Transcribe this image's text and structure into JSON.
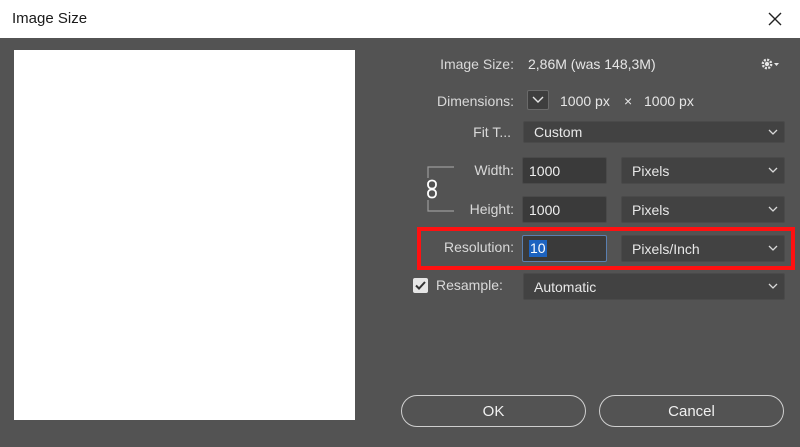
{
  "window": {
    "title": "Image Size"
  },
  "image_size": {
    "label": "Image Size:",
    "value": "2,86M (was 148,3M)"
  },
  "dimensions": {
    "label": "Dimensions:",
    "width": "1000 px",
    "times": "×",
    "height": "1000 px"
  },
  "fit_to": {
    "label": "Fit T...",
    "value": "Custom"
  },
  "width": {
    "label": "Width:",
    "value": "1000",
    "unit": "Pixels"
  },
  "height": {
    "label": "Height:",
    "value": "1000",
    "unit": "Pixels"
  },
  "resolution": {
    "label": "Resolution:",
    "value": "10",
    "unit": "Pixels/Inch"
  },
  "resample": {
    "label": "Resample:",
    "value": "Automatic",
    "checked": true
  },
  "buttons": {
    "ok": "OK",
    "cancel": "Cancel"
  },
  "icons": {
    "close": "close-icon",
    "gear": "gear-icon",
    "dimensions_toggle": "chevron-down-icon",
    "link": "chain-link-icon",
    "check": "checkmark-icon"
  },
  "colors": {
    "dialog_bg": "#535353",
    "titlebar_bg": "#ffffff",
    "field_bg": "#424242",
    "selection": "#1d63c0",
    "highlight": "#ff1111"
  }
}
